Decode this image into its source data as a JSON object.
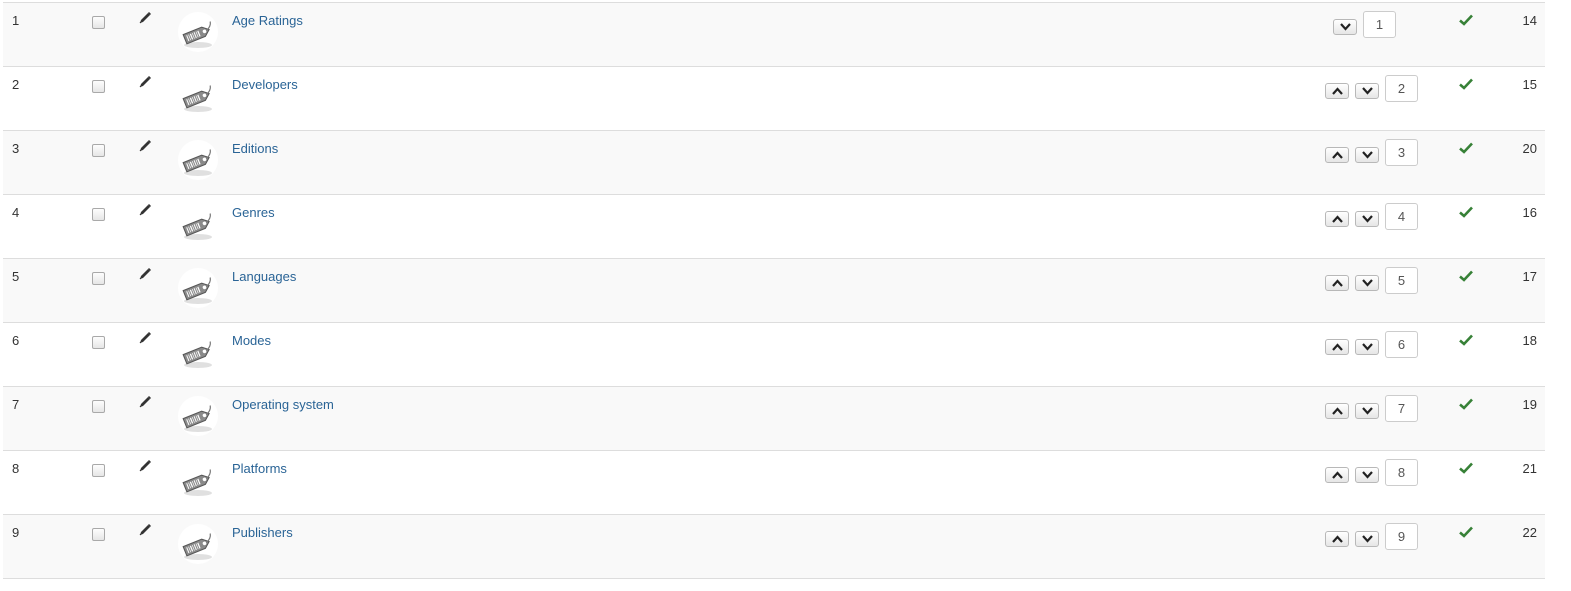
{
  "rows": [
    {
      "num": "1",
      "title": "Age Ratings",
      "order": "1",
      "id": "14"
    },
    {
      "num": "2",
      "title": "Developers",
      "order": "2",
      "id": "15"
    },
    {
      "num": "3",
      "title": "Editions",
      "order": "3",
      "id": "20"
    },
    {
      "num": "4",
      "title": "Genres",
      "order": "4",
      "id": "16"
    },
    {
      "num": "5",
      "title": "Languages",
      "order": "5",
      "id": "17"
    },
    {
      "num": "6",
      "title": "Modes",
      "order": "6",
      "id": "18"
    },
    {
      "num": "7",
      "title": "Operating system",
      "order": "7",
      "id": "19"
    },
    {
      "num": "8",
      "title": "Platforms",
      "order": "8",
      "id": "21"
    },
    {
      "num": "9",
      "title": "Publishers",
      "order": "9",
      "id": "22"
    }
  ],
  "icons": {
    "edit": "pencil-icon",
    "avatar": "tag-icon",
    "status": "check-icon",
    "move_up": "chevron-up-icon",
    "move_down": "chevron-down-icon"
  },
  "colors": {
    "link": "#2a6496",
    "published": "#378137",
    "row_alt": "#f9f9f9",
    "border": "#dddddd"
  }
}
